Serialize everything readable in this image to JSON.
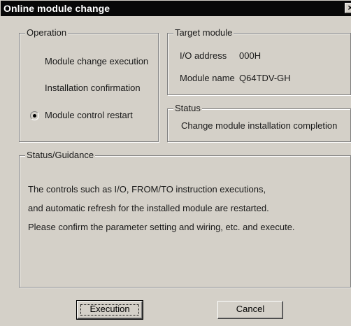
{
  "window": {
    "title": "Online module change",
    "close_glyph": "×"
  },
  "operation": {
    "legend": "Operation",
    "items": [
      {
        "label": "Module change execution",
        "selected": false
      },
      {
        "label": "Installation confirmation",
        "selected": false
      },
      {
        "label": "Module control restart",
        "selected": true
      }
    ]
  },
  "target": {
    "legend": "Target module",
    "io_label": "I/O address",
    "io_value": "000H",
    "name_label": "Module name",
    "name_value": "Q64TDV-GH"
  },
  "status": {
    "legend": "Status",
    "text": "Change module installation completion"
  },
  "guidance": {
    "legend": "Status/Guidance",
    "lines": [
      "The controls such as I/O, FROM/TO instruction executions,",
      "and automatic refresh for the installed module are restarted.",
      "Please confirm the parameter setting and wiring, etc. and execute."
    ]
  },
  "buttons": {
    "execute_label": "Execution",
    "cancel_label": "Cancel"
  }
}
